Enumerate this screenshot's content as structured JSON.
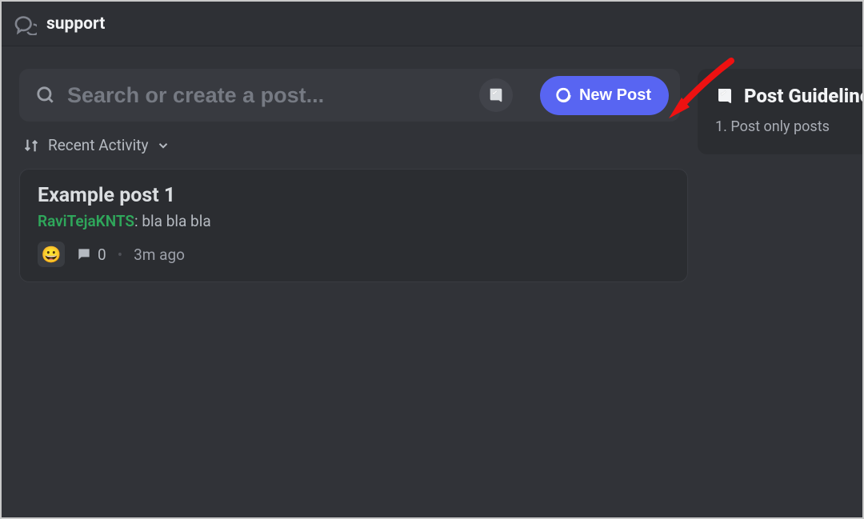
{
  "header": {
    "title": "support"
  },
  "search": {
    "placeholder": "Search or create a post..."
  },
  "buttons": {
    "new_post": "New Post"
  },
  "sort": {
    "label": "Recent Activity"
  },
  "posts": [
    {
      "title": "Example post 1",
      "author": "RaviTejaKNTS",
      "preview": "bla bla bla",
      "reaction_emoji": "😀",
      "message_count": "0",
      "timestamp": "3m ago"
    }
  ],
  "sidebar": {
    "guidelines_title": "Post Guidelines",
    "guidelines_body": "1. Post only posts"
  }
}
